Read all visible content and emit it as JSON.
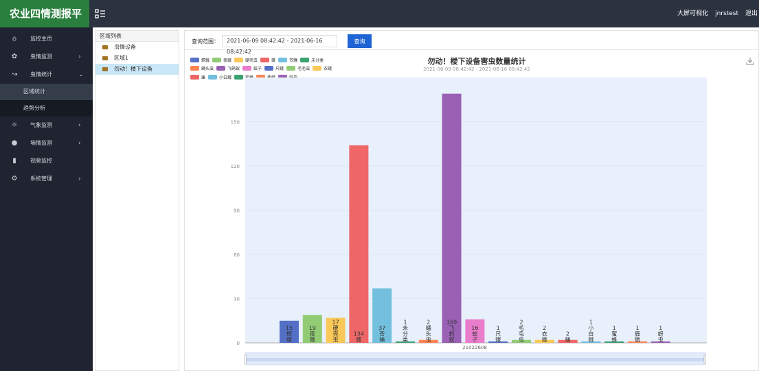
{
  "brand": {
    "name": "农业四情测报平台"
  },
  "topbar": {
    "big_screen": "大屏可视化",
    "user": "jnrstest",
    "logout": "退出"
  },
  "sidebar": {
    "items": [
      {
        "label": "监控主页",
        "icon": "home-icon"
      },
      {
        "label": "虫情监测",
        "icon": "bug-icon"
      },
      {
        "label": "虫情统计",
        "icon": "chart-icon"
      },
      {
        "label": "区域统计",
        "sub": true,
        "active": true
      },
      {
        "label": "趋势分析",
        "sub": true
      },
      {
        "label": "气象监测",
        "icon": "weather-icon"
      },
      {
        "label": "墒情监测",
        "icon": "globe-icon"
      },
      {
        "label": "视频监控",
        "icon": "video-icon"
      },
      {
        "label": "系统管理",
        "icon": "gear-icon"
      }
    ]
  },
  "tree": {
    "title": "区域列表",
    "nodes": [
      {
        "label": "虫情设备",
        "indent": 0
      },
      {
        "label": "区域1",
        "indent": 0
      },
      {
        "label": "勿动！楼下设备",
        "indent": 0,
        "selected": true
      }
    ]
  },
  "query": {
    "label": "查询范围：",
    "range": "2021-06-09 08:42:42 - 2021-06-16 08:42:42",
    "button": "查询"
  },
  "chart_data": {
    "type": "bar",
    "title": "勿动！楼下设备害虫数量统计",
    "subtitle": "2021-06-09 08:42:42 - 2021-06-16 08:42:42",
    "x_category": "21022608",
    "ylim": [
      0,
      180
    ],
    "yticks": [
      0,
      30,
      60,
      90,
      120,
      150
    ],
    "grid": true,
    "legend_position": "top-left",
    "series": [
      {
        "name": "螟蛾",
        "value": 15,
        "color": "#5470c6"
      },
      {
        "name": "夜蛾",
        "value": 19,
        "color": "#91cc75"
      },
      {
        "name": "硬壳虫",
        "value": 17,
        "color": "#fac858"
      },
      {
        "name": "蝼",
        "value": 134,
        "color": "#ee6666"
      },
      {
        "name": "苍蝇",
        "value": 37,
        "color": "#73c0de"
      },
      {
        "name": "未分类",
        "value": 1,
        "color": "#3ba272"
      },
      {
        "name": "蛹头虫",
        "value": 2,
        "color": "#fc8452"
      },
      {
        "name": "飞蚂蚁",
        "value": 169,
        "color": "#9a60b4"
      },
      {
        "name": "蚊子",
        "value": 16,
        "color": "#ea7ccc"
      },
      {
        "name": "尺蛾",
        "value": 1,
        "color": "#5470c6"
      },
      {
        "name": "毛毛虫",
        "value": 2,
        "color": "#91cc75"
      },
      {
        "name": "衣蛾",
        "value": 2,
        "color": "#fac858"
      },
      {
        "name": "蝽",
        "value": 2,
        "color": "#ee6666"
      },
      {
        "name": "小白蛾",
        "value": 1,
        "color": "#73c0de"
      },
      {
        "name": "蜜蜂",
        "value": 1,
        "color": "#3ba272"
      },
      {
        "name": "鹿蛾",
        "value": 1,
        "color": "#fc8452"
      },
      {
        "name": "蚜虫",
        "value": 1,
        "color": "#9a60b4"
      }
    ]
  }
}
